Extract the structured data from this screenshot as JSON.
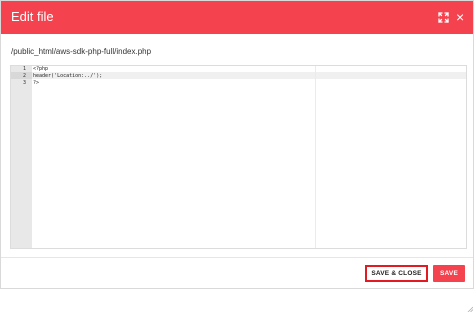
{
  "dialog": {
    "title": "Edit file",
    "maximize_icon": "maximize-icon",
    "close_icon": "close-icon",
    "close_glyph": "×"
  },
  "file": {
    "path": "/public_html/aws-sdk-php-full/index.php"
  },
  "editor": {
    "active_line": 2,
    "lines": [
      {
        "number": "1",
        "text": "<?php"
      },
      {
        "number": "2",
        "text": "header('Location:../');"
      },
      {
        "number": "3",
        "text": "?>"
      }
    ]
  },
  "footer": {
    "save_close_label": "SAVE & CLOSE",
    "save_label": "SAVE"
  },
  "colors": {
    "header_bg": "#f4434f",
    "accent_border": "#e21a22",
    "save_button_bg": "#f4434f"
  }
}
